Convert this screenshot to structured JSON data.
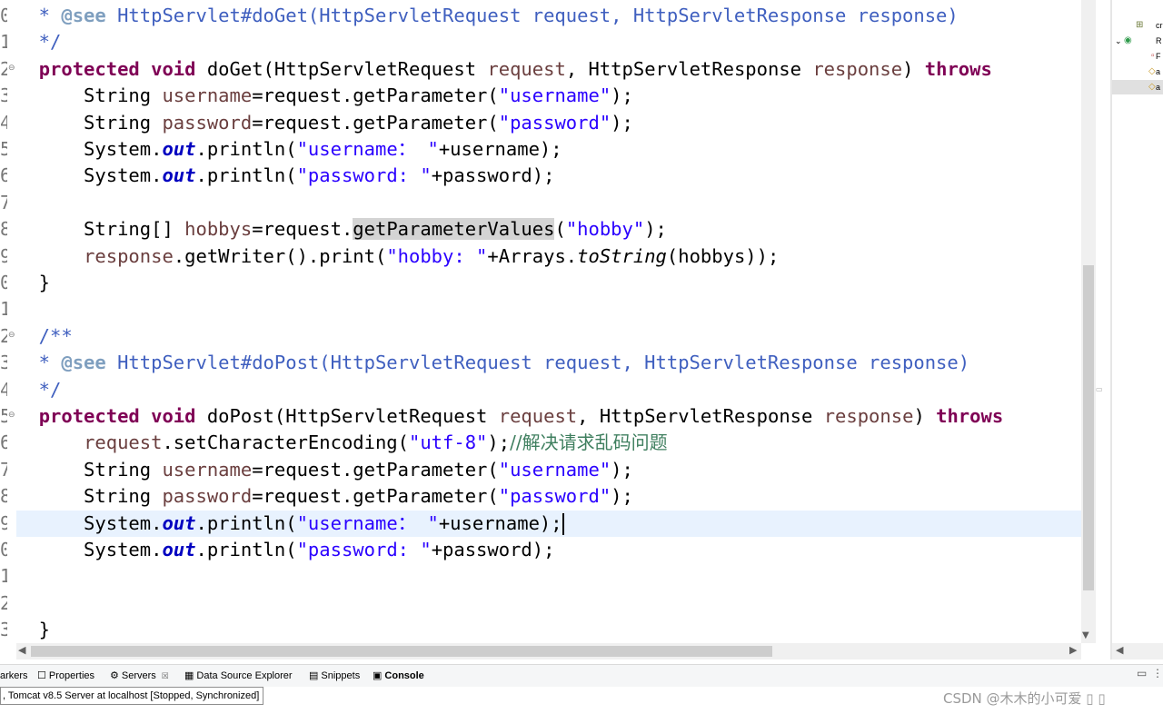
{
  "editor": {
    "gutter": [
      {
        "num": "0",
        "fold": ""
      },
      {
        "num": "1",
        "fold": ""
      },
      {
        "num": "2",
        "fold": "⊖"
      },
      {
        "num": "3",
        "fold": ""
      },
      {
        "num": "4",
        "fold": ""
      },
      {
        "num": "5",
        "fold": ""
      },
      {
        "num": "6",
        "fold": ""
      },
      {
        "num": "7",
        "fold": ""
      },
      {
        "num": "8",
        "fold": ""
      },
      {
        "num": "9",
        "fold": ""
      },
      {
        "num": "0",
        "fold": ""
      },
      {
        "num": "1",
        "fold": ""
      },
      {
        "num": "2",
        "fold": "⊖"
      },
      {
        "num": "3",
        "fold": ""
      },
      {
        "num": "4",
        "fold": ""
      },
      {
        "num": "5",
        "fold": "⊖"
      },
      {
        "num": "6",
        "fold": ""
      },
      {
        "num": "7",
        "fold": ""
      },
      {
        "num": "8",
        "fold": ""
      },
      {
        "num": "9",
        "fold": ""
      },
      {
        "num": "0",
        "fold": ""
      },
      {
        "num": "1",
        "fold": ""
      },
      {
        "num": "2",
        "fold": ""
      },
      {
        "num": "3",
        "fold": ""
      }
    ],
    "current_line_index": 19,
    "lines": [
      [
        [
          "jdoc",
          "  * "
        ],
        [
          "jdoc-tag",
          "@see"
        ],
        [
          "jdoc",
          " HttpServlet#doGet(HttpServletRequest request, HttpServletResponse response)"
        ]
      ],
      [
        [
          "jdoc",
          "  */"
        ]
      ],
      [
        [
          "",
          "  "
        ],
        [
          "kw",
          "protected"
        ],
        [
          "",
          " "
        ],
        [
          "kw",
          "void"
        ],
        [
          "",
          " doGet(HttpServletRequest "
        ],
        [
          "var",
          "request"
        ],
        [
          "",
          ", HttpServletResponse "
        ],
        [
          "var",
          "response"
        ],
        [
          "",
          ") "
        ],
        [
          "kw",
          "throws"
        ]
      ],
      [
        [
          "",
          "      String "
        ],
        [
          "var",
          "username"
        ],
        [
          "",
          "=request.getParameter("
        ],
        [
          "str",
          "\"username\""
        ],
        [
          "",
          ");"
        ]
      ],
      [
        [
          "",
          "      String "
        ],
        [
          "var",
          "password"
        ],
        [
          "",
          "=request.getParameter("
        ],
        [
          "str",
          "\"password\""
        ],
        [
          "",
          ");"
        ]
      ],
      [
        [
          "",
          "      System."
        ],
        [
          "fld",
          "out"
        ],
        [
          "",
          ".println("
        ],
        [
          "str",
          "\"username： \""
        ],
        [
          "",
          "+username);"
        ]
      ],
      [
        [
          "",
          "      System."
        ],
        [
          "fld",
          "out"
        ],
        [
          "",
          ".println("
        ],
        [
          "str",
          "\"password: \""
        ],
        [
          "",
          "+password);"
        ]
      ],
      [],
      [
        [
          "",
          "      String[] "
        ],
        [
          "var",
          "hobbys"
        ],
        [
          "",
          "=request."
        ],
        [
          "hl",
          "getParameterValues"
        ],
        [
          "",
          "("
        ],
        [
          "str",
          "\"hobby\""
        ],
        [
          "",
          ");"
        ]
      ],
      [
        [
          "",
          "      "
        ],
        [
          "var",
          "response"
        ],
        [
          "",
          ".getWriter().print("
        ],
        [
          "str",
          "\"hobby: \""
        ],
        [
          "",
          "+Arrays."
        ],
        [
          "mth-static",
          "toString"
        ],
        [
          "",
          "(hobbys));"
        ]
      ],
      [
        [
          "",
          "  }"
        ]
      ],
      [],
      [
        [
          "jdoc",
          "  /**"
        ]
      ],
      [
        [
          "jdoc",
          "  * "
        ],
        [
          "jdoc-tag",
          "@see"
        ],
        [
          "jdoc",
          " HttpServlet#doPost(HttpServletRequest request, HttpServletResponse response)"
        ]
      ],
      [
        [
          "jdoc",
          "  */"
        ]
      ],
      [
        [
          "",
          "  "
        ],
        [
          "kw",
          "protected"
        ],
        [
          "",
          " "
        ],
        [
          "kw",
          "void"
        ],
        [
          "",
          " doPost(HttpServletRequest "
        ],
        [
          "var",
          "request"
        ],
        [
          "",
          ", HttpServletResponse "
        ],
        [
          "var",
          "response"
        ],
        [
          "",
          ") "
        ],
        [
          "kw",
          "throws"
        ]
      ],
      [
        [
          "",
          "      "
        ],
        [
          "var",
          "request"
        ],
        [
          "",
          ".setCharacterEncoding("
        ],
        [
          "str",
          "\"utf-8\""
        ],
        [
          "",
          ");"
        ],
        [
          "cmt",
          "//解决请求乱码问题"
        ]
      ],
      [
        [
          "",
          "      String "
        ],
        [
          "var",
          "username"
        ],
        [
          "",
          "=request.getParameter("
        ],
        [
          "str",
          "\"username\""
        ],
        [
          "",
          ");"
        ]
      ],
      [
        [
          "",
          "      String "
        ],
        [
          "var",
          "password"
        ],
        [
          "",
          "=request.getParameter("
        ],
        [
          "str",
          "\"password\""
        ],
        [
          "",
          ");"
        ]
      ],
      [
        [
          "",
          "      System."
        ],
        [
          "fld",
          "out"
        ],
        [
          "",
          ".println("
        ],
        [
          "str",
          "\"username： \""
        ],
        [
          "",
          "+username);"
        ]
      ],
      [
        [
          "",
          "      System."
        ],
        [
          "fld",
          "out"
        ],
        [
          "",
          ".println("
        ],
        [
          "str",
          "\"password: \""
        ],
        [
          "",
          "+password);"
        ]
      ],
      [],
      [],
      [
        [
          "",
          "  }"
        ]
      ]
    ]
  },
  "outline": {
    "rows": [
      {
        "icon": "⊞",
        "icon_color": "#6d7b3a",
        "label": "cr"
      },
      {
        "icon": "◉",
        "icon_color": "#2e9a4a",
        "label": "R"
      },
      {
        "icon": "▫",
        "icon_color": "#c04040",
        "label": "F"
      },
      {
        "icon": "◇",
        "icon_color": "#c89a2a",
        "label": "a"
      },
      {
        "icon": "◇",
        "icon_color": "#c89a2a",
        "label": "a"
      }
    ]
  },
  "views": {
    "tabs": [
      {
        "name": "markers",
        "icon": "",
        "label": "arkers",
        "active": false,
        "closable": false
      },
      {
        "name": "properties",
        "icon": "☐",
        "label": "Properties",
        "active": false,
        "closable": false
      },
      {
        "name": "servers",
        "icon": "⚙",
        "label": "Servers",
        "active": false,
        "closable": true
      },
      {
        "name": "data-source-explorer",
        "icon": "▦",
        "label": "Data Source Explorer",
        "active": false,
        "closable": false
      },
      {
        "name": "snippets",
        "icon": "▤",
        "label": "Snippets",
        "active": false,
        "closable": false
      },
      {
        "name": "console",
        "icon": "▣",
        "label": "Console",
        "active": true,
        "closable": false
      }
    ],
    "close_glyph": "☒"
  },
  "servers": {
    "row_text": ", Tomcat v8.5 Server at localhost  [Stopped, Synchronized]"
  },
  "watermark": "CSDN @木木的小可爱 ▯ ▯",
  "colors": {
    "keyword": "#7f0055",
    "string": "#2a00ff",
    "local_var": "#6a3e3e",
    "field": "#0000c0",
    "javadoc": "#3f5fbf",
    "comment": "#3f7f5f",
    "current_line": "#e8f2fe"
  }
}
